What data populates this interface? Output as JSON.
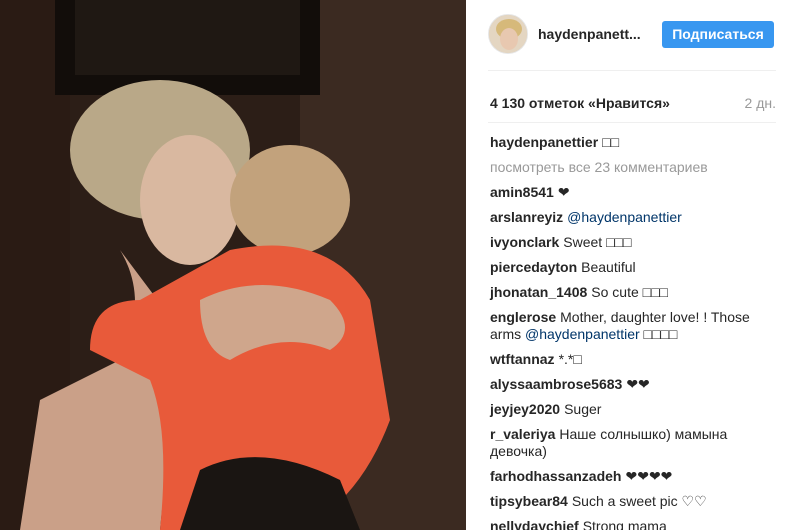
{
  "post": {
    "username": "haydenpanett...",
    "follow_label": "Подписаться",
    "likes": "4 130 отметок «Нравится»",
    "time": "2 дн.",
    "caption_user": "haydenpanettier",
    "caption_text": "□□",
    "view_all": "посмотреть все 23 комментариев"
  },
  "comments": [
    {
      "user": "amin8541",
      "text": "❤"
    },
    {
      "user": "arslanreyiz",
      "mention": "@haydenpanettier"
    },
    {
      "user": "ivyonclark",
      "text": "Sweet □□□"
    },
    {
      "user": "piercedayton",
      "text": "Beautiful"
    },
    {
      "user": "jhonatan_1408",
      "text": "So cute □□□"
    },
    {
      "user": "englerose",
      "text": "Mother, daughter love! ! Those arms",
      "mention": "@haydenpanettier",
      "after": "□□□□"
    },
    {
      "user": "wtftannaz",
      "text": "*.*□"
    },
    {
      "user": "alyssaambrose5683",
      "text": "❤❤"
    },
    {
      "user": "jeyjey2020",
      "text": "Suger"
    },
    {
      "user": "r_valeriya",
      "text": "Наше солнышко) мамына девочка)"
    },
    {
      "user": "farhodhassanzadeh",
      "text": "❤❤❤❤"
    },
    {
      "user": "tipsybear84",
      "text": "Such a sweet pic ♡♡"
    },
    {
      "user": "nellydaychief",
      "text": "Strong mama"
    }
  ]
}
